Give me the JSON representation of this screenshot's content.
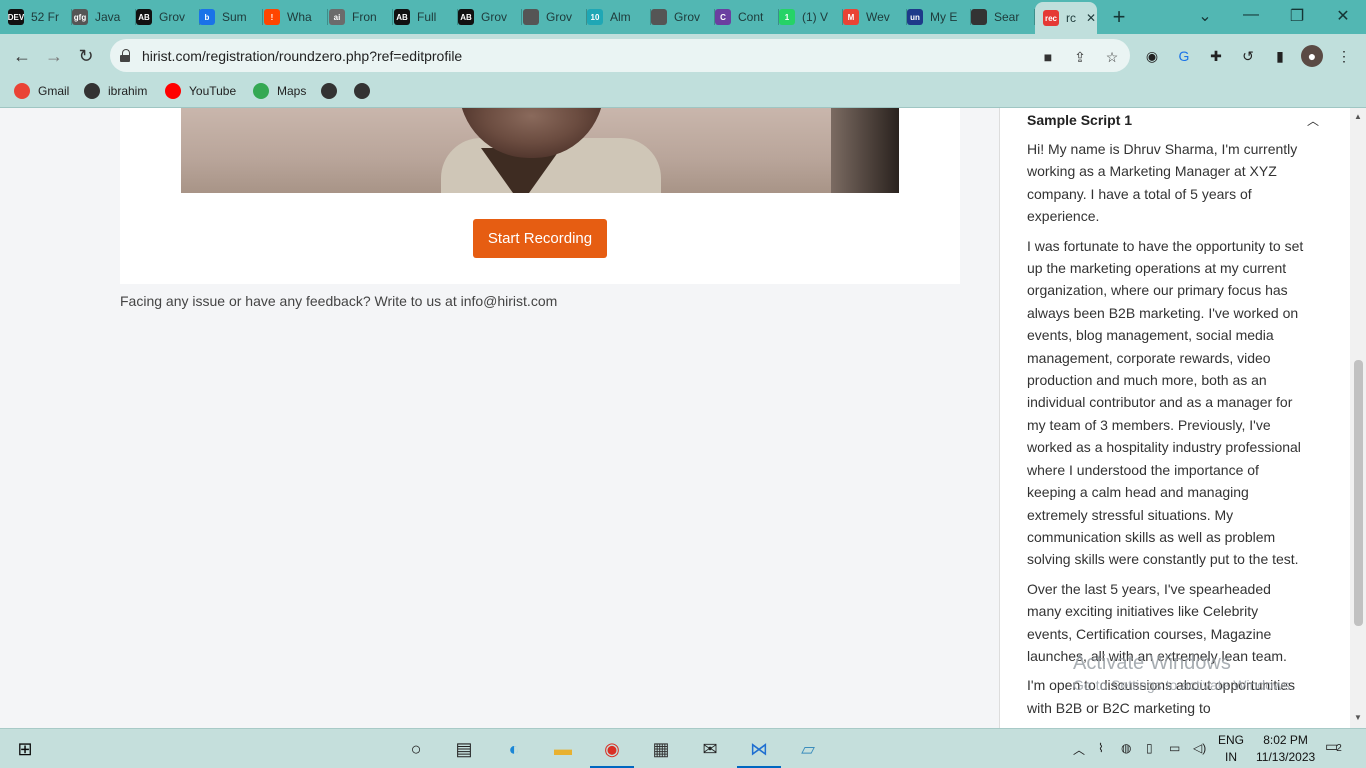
{
  "browser": {
    "tabs": [
      {
        "label": "52 Fr",
        "favicon": "DEV",
        "color": "#111111"
      },
      {
        "label": "Java",
        "favicon": "gfg",
        "color": "#555555"
      },
      {
        "label": "Grov",
        "favicon": "AB",
        "color": "#111111"
      },
      {
        "label": "Sum",
        "favicon": "b",
        "color": "#1a73e8"
      },
      {
        "label": "Wha",
        "favicon": "!",
        "color": "#ff4500"
      },
      {
        "label": "Fron",
        "favicon": "ai",
        "color": "#6b6b6b"
      },
      {
        "label": "Full",
        "favicon": "AB",
        "color": "#111111"
      },
      {
        "label": "Grov",
        "favicon": "AB",
        "color": "#111111"
      },
      {
        "label": "Grov",
        "favicon": "globe",
        "color": "#555555"
      },
      {
        "label": "Alm",
        "favicon": "10",
        "color": "#1fa7b5"
      },
      {
        "label": "Grov",
        "favicon": "globe",
        "color": "#555555"
      },
      {
        "label": "Cont",
        "favicon": "C",
        "color": "#6b3fa0"
      },
      {
        "label": "(1) V",
        "favicon": "1",
        "color": "#25d366"
      },
      {
        "label": "Wev",
        "favicon": "M",
        "color": "#ea4335"
      },
      {
        "label": "My E",
        "favicon": "un",
        "color": "#1e3a8a"
      },
      {
        "label": "Sear",
        "favicon": "gear",
        "color": "#333333"
      },
      {
        "label": "rc",
        "favicon": "rec",
        "color": "#e53935"
      }
    ],
    "new_tab_icon": "+",
    "url": "hirist.com/registration/roundzero.php?ref=editprofile",
    "bookmarks": [
      {
        "label": "Gmail",
        "icon": "gmail-icon",
        "color": "#ea4335"
      },
      {
        "label": "ibrahim",
        "icon": "globe-icon",
        "color": "#333333"
      },
      {
        "label": "YouTube",
        "icon": "youtube-icon",
        "color": "#ff0000"
      },
      {
        "label": "Maps",
        "icon": "maps-icon",
        "color": "#34a853"
      },
      {
        "label": "",
        "icon": "globe-icon",
        "color": "#333333"
      },
      {
        "label": "",
        "icon": "globe-icon",
        "color": "#333333"
      }
    ]
  },
  "page": {
    "record_button": "Start Recording",
    "feedback": "Facing any issue or have any feedback? Write to us at info@hirist.com",
    "accent_color": "#e65d12"
  },
  "sidepanel": {
    "title": "Sample Script 1",
    "paragraphs": [
      "Hi! My name is Dhruv Sharma, I'm currently working as a Marketing Manager at XYZ company. I have a total of 5 years of experience.",
      "I was fortunate to have the opportunity to set up the marketing operations at my current organization, where our primary focus has always been B2B marketing. I've worked on events, blog management, social media management, corporate rewards, video production and much more, both as an individual contributor and as a manager for my team of 3 members. Previously, I've worked as a hospitality industry professional where I understood the importance of keeping a calm head and managing extremely stressful situations. My communication skills as well as problem solving skills were constantly put to the test.",
      "Over the last 5 years, I've spearheaded many exciting initiatives like Celebrity events, Certification courses, Magazine launches, all with an extremely lean team.",
      "I'm open to discussions about opportunities with B2B or B2C marketing to"
    ]
  },
  "watermark": {
    "line1": "Activate Windows",
    "line2": "Go to Settings to activate Windows."
  },
  "taskbar": {
    "language": "ENG",
    "region": "IN",
    "time": "8:02 PM",
    "date": "11/13/2023",
    "notifications": "2"
  }
}
